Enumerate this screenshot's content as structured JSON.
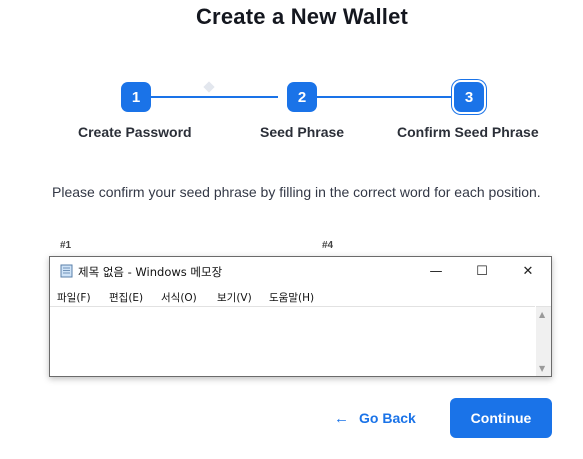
{
  "page": {
    "title": "Create a New Wallet"
  },
  "stepper": {
    "steps": [
      {
        "number": "1",
        "label": "Create Password"
      },
      {
        "number": "2",
        "label": "Seed Phrase"
      },
      {
        "number": "3",
        "label": "Confirm Seed Phrase"
      }
    ],
    "active_step": 3,
    "accent": "#1a73e8"
  },
  "instruction": "Please confirm your seed phrase by filling in the correct word for each position.",
  "positions": [
    "#1",
    "#4"
  ],
  "notepad": {
    "icon": "notepad-icon",
    "title": "제목 없음 - Windows 메모장",
    "controls": {
      "minimize": "—",
      "maximize": "☐",
      "close": "✕"
    },
    "menu": [
      "파일(F)",
      "편집(E)",
      "서식(O)",
      "보기(V)",
      "도움말(H)"
    ],
    "content": ""
  },
  "actions": {
    "back_label": "Go Back",
    "back_icon": "←",
    "continue_label": "Continue"
  }
}
